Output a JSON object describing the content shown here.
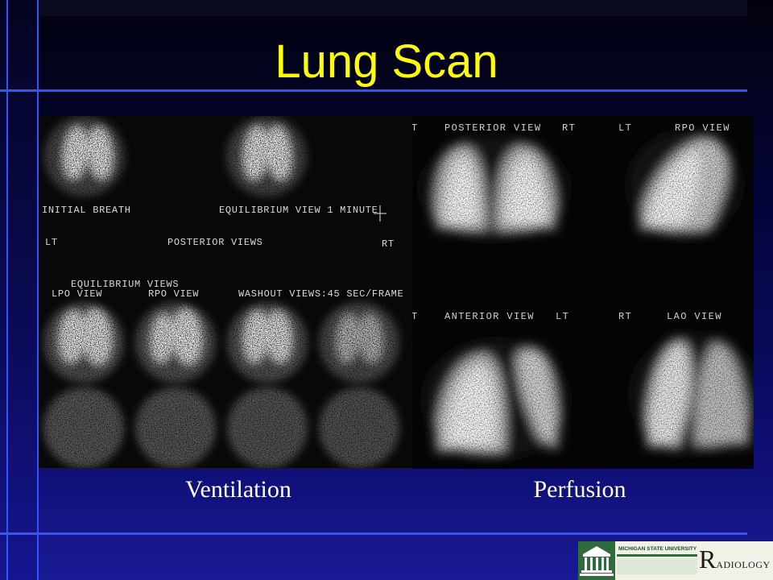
{
  "slide": {
    "title": "Lung Scan"
  },
  "ventilation": {
    "caption": "Ventilation",
    "labels": {
      "initial_breath": "INITIAL BREATH",
      "equilibrium_view_1_minute": "EQUILIBRIUM VIEW 1 MINUTE",
      "left_marker": "LT",
      "posterior_views": "POSTERIOR VIEWS",
      "right_marker": "RT",
      "equilibrium_views": "EQUILIBRIUM VIEWS",
      "lpo_view": "LPO VIEW",
      "rpo_view": "RPO VIEW",
      "washout_views": "WASHOUT VIEWS:45 SEC/FRAME"
    }
  },
  "perfusion": {
    "caption": "Perfusion",
    "labels": {
      "top_edge_marker": "T",
      "posterior_view": "POSTERIOR VIEW",
      "posterior_right_marker": "RT",
      "rpo_left_marker": "LT",
      "rpo_view": "RPO VIEW",
      "bottom_edge_marker": "T",
      "anterior_view": "ANTERIOR VIEW",
      "anterior_left_marker": "LT",
      "lao_right_marker": "RT",
      "lao_view": "LAO VIEW"
    }
  },
  "logo": {
    "university": "MICHIGAN STATE UNIVERSITY",
    "department": "RADIOLOGY",
    "icon": "building-icon"
  },
  "colors": {
    "title": "#ffff00",
    "caption": "#ffffff",
    "rule_lines": "#3355ff",
    "background_top": "#02020e",
    "background_bottom": "#1a1a96",
    "logo_green": "#2f6b3c"
  }
}
